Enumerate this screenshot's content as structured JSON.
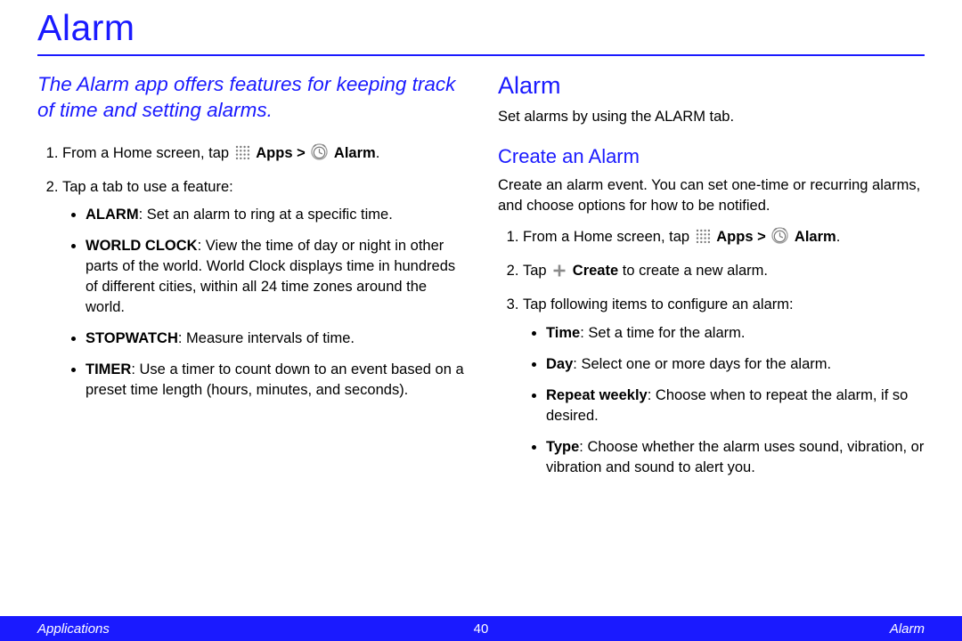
{
  "title": "Alarm",
  "intro": "The Alarm app offers features for keeping track of time and setting alarms.",
  "left": {
    "step1_prefix": "From a Home screen, tap ",
    "apps_label": "Apps > ",
    "alarm_label": "Alarm",
    "step2": "Tap a tab to use a feature:",
    "tabs": {
      "alarm_name": "ALARM",
      "alarm_desc": ": Set an alarm to ring at a specific time.",
      "world_name": "WORLD CLOCK",
      "world_desc": ": View the time of day or night in other parts of the world. World Clock displays time in hundreds of different cities, within all 24 time zones around the world.",
      "stopwatch_name": "STOPWATCH",
      "stopwatch_desc": ": Measure intervals of time.",
      "timer_name": "TIMER",
      "timer_desc": ": Use a timer to count down to an event based on a preset time length (hours, minutes, and seconds)."
    }
  },
  "right": {
    "h2": "Alarm",
    "alarm_body": "Set alarms by using the ALARM tab.",
    "h3": "Create an Alarm",
    "create_body": "Create an alarm event. You can set one-time or recurring alarms, and choose options for how to be notified.",
    "step1_prefix": "From a Home screen, tap ",
    "apps_label": "Apps > ",
    "alarm_label": "Alarm",
    "step2_prefix": "Tap ",
    "create_label": "Create",
    "step2_suffix": " to create a new alarm.",
    "step3": "Tap following items to configure an alarm:",
    "opts": {
      "time_name": "Time",
      "time_desc": ": Set a time for the alarm.",
      "day_name": "Day",
      "day_desc": ": Select one or more days for the alarm.",
      "repeat_name": "Repeat weekly",
      "repeat_desc": ": Choose when to repeat the alarm, if so desired.",
      "type_name": "Type",
      "type_desc": ": Choose whether the alarm uses sound, vibration, or vibration and sound to alert you."
    }
  },
  "footer": {
    "left": "Applications",
    "page": "40",
    "right": "Alarm"
  },
  "period": "."
}
